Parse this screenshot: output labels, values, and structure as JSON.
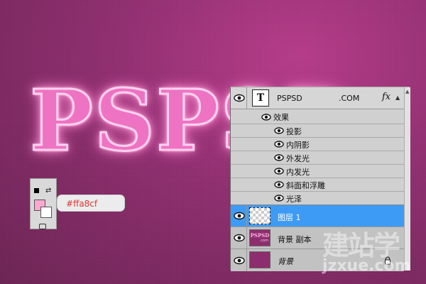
{
  "canvas": {
    "artwork_text": "PSPSD",
    "hex_color": "#ffa8cf",
    "foreground_color": "#ffa8cf",
    "background_color": "#ffffff"
  },
  "layers_panel": {
    "text_layer": {
      "thumb_letter": "T",
      "name": "PSPSD",
      "suffix": ".COM",
      "fx_label": "fx"
    },
    "effects_label": "效果",
    "effects": [
      "投影",
      "内阴影",
      "外发光",
      "内发光",
      "斜面和浮雕",
      "光泽"
    ],
    "selected_layer": {
      "name": "图层 1"
    },
    "copy_layer": {
      "name": "背景 副本",
      "thumb_text": "PSPSD",
      "thumb_sub": ".com"
    },
    "background_layer": {
      "name": "背景"
    }
  },
  "watermark": {
    "main": "建站学",
    "sub": "jzxue.com"
  }
}
